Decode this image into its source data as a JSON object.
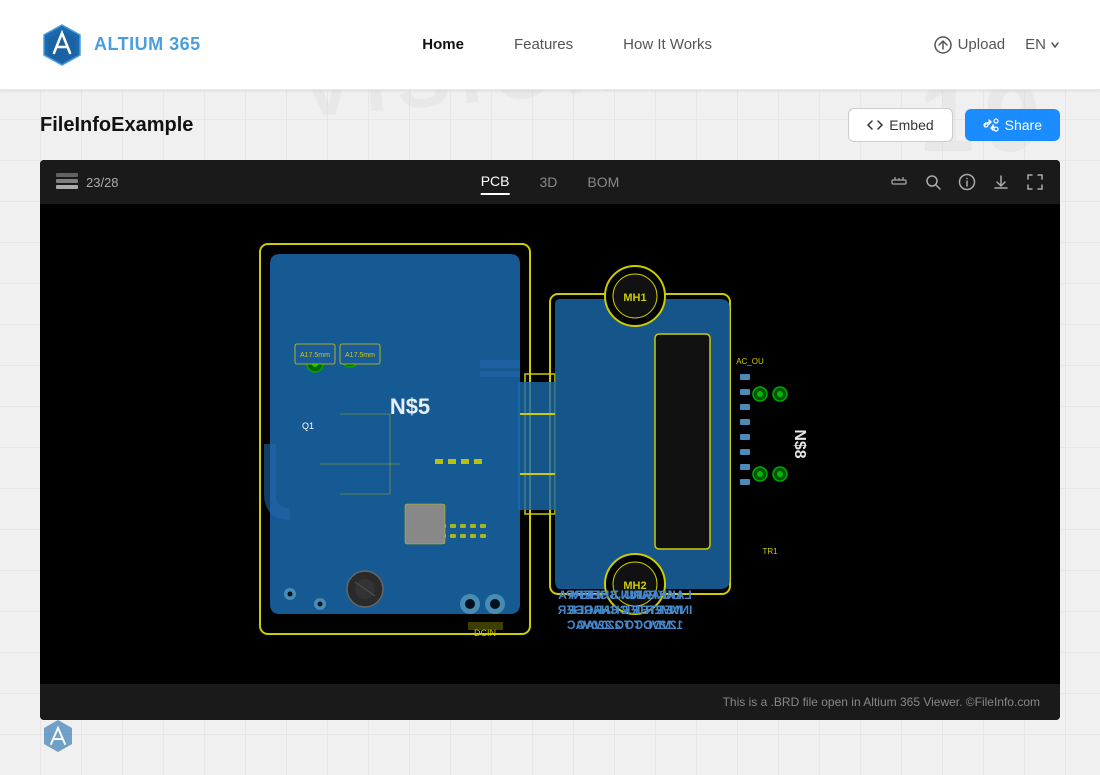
{
  "header": {
    "logo_text": "ALTIUM",
    "logo_suffix": " 365",
    "nav": {
      "home": "Home",
      "features": "Features",
      "how_it_works": "How It Works",
      "upload": "Upload",
      "lang": "EN"
    }
  },
  "file_bar": {
    "title": "FileInfoExample",
    "embed_label": "Embed",
    "share_label": "Share"
  },
  "viewer": {
    "layer_count": "23/28",
    "tab_pcb": "PCB",
    "tab_3d": "3D",
    "tab_bom": "BOM",
    "active_tab": "PCB",
    "footer_text": "This is a .BRD file open in Altium 365 Viewer. ©FileInfo.com"
  }
}
